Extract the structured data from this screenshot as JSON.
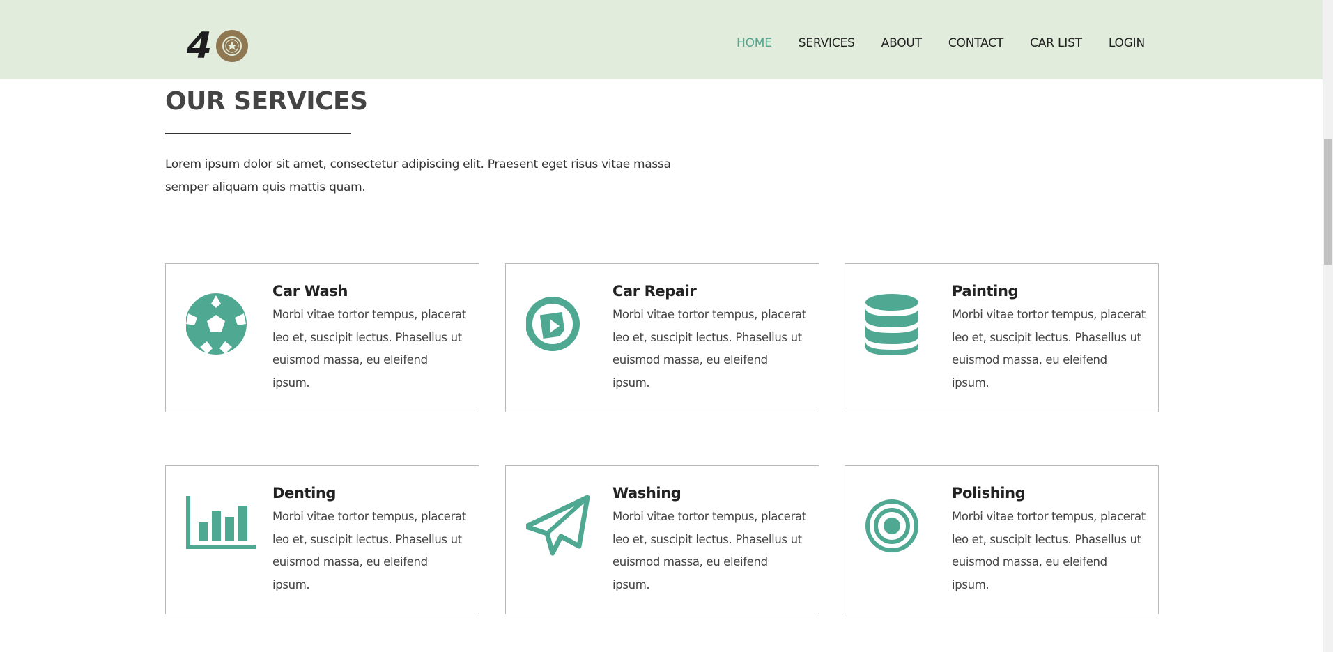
{
  "header": {
    "logo_text": "4",
    "nav": [
      {
        "label": "HOME",
        "active": true
      },
      {
        "label": "SERVICES",
        "active": false
      },
      {
        "label": "ABOUT",
        "active": false
      },
      {
        "label": "CONTACT",
        "active": false
      },
      {
        "label": "CAR LIST",
        "active": false
      },
      {
        "label": "LOGIN",
        "active": false
      }
    ]
  },
  "services": {
    "title": "OUR SERVICES",
    "intro": "Lorem ipsum dolor sit amet, consectetur adipiscing elit. Praesent eget risus vitae massa semper aliquam quis mattis quam.",
    "cards": [
      {
        "title": "Car Wash",
        "icon": "soccer-ball-icon",
        "text": "Morbi vitae tortor tempus, placerat leo et, suscipit lectus. Phasellus ut euismod massa, eu eleifend ipsum."
      },
      {
        "title": "Car Repair",
        "icon": "play-circle-icon",
        "text": "Morbi vitae tortor tempus, placerat leo et, suscipit lectus. Phasellus ut euismod massa, eu eleifend ipsum."
      },
      {
        "title": "Painting",
        "icon": "database-icon",
        "text": "Morbi vitae tortor tempus, placerat leo et, suscipit lectus. Phasellus ut euismod massa, eu eleifend ipsum."
      },
      {
        "title": "Denting",
        "icon": "bar-chart-icon",
        "text": "Morbi vitae tortor tempus, placerat leo et, suscipit lectus. Phasellus ut euismod massa, eu eleifend ipsum."
      },
      {
        "title": "Washing",
        "icon": "paper-plane-icon",
        "text": "Morbi vitae tortor tempus, placerat leo et, suscipit lectus. Phasellus ut euismod massa, eu eleifend ipsum."
      },
      {
        "title": "Polishing",
        "icon": "target-icon",
        "text": "Morbi vitae tortor tempus, placerat leo et, suscipit lectus. Phasellus ut euismod massa, eu eleifend ipsum."
      }
    ]
  },
  "colors": {
    "header_bg": "#e1ecdc",
    "accent": "#4fa891",
    "logo_gold": "#8f7851"
  }
}
